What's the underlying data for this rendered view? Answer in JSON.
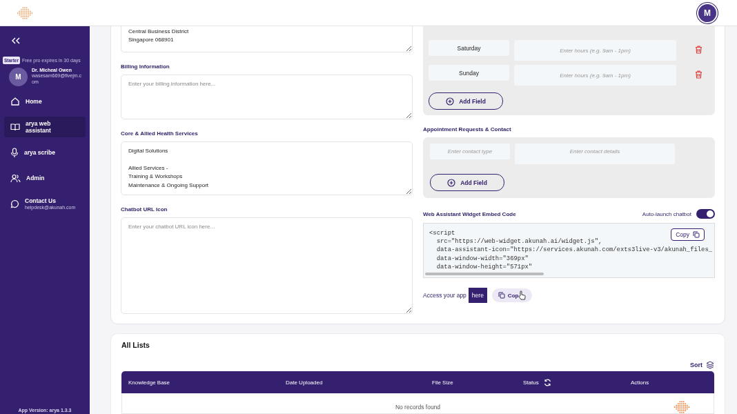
{
  "sidebar": {
    "plan_badge": "Starter",
    "plan_note": "Free pro expires in 30 days",
    "user": {
      "initial": "M",
      "name": "Dr. Micheal Owen",
      "email": "wasesam669@fivejm.com"
    },
    "items": [
      {
        "label": "Home",
        "selected": false
      },
      {
        "label": "arya web assistant",
        "selected": true
      },
      {
        "label": "arya scribe",
        "selected": false
      },
      {
        "label": "Admin",
        "selected": false
      },
      {
        "label": "Contact Us",
        "selected": false,
        "sub": "helpdesk@akunah.com"
      }
    ],
    "version": "App Version: arya 1.3.3"
  },
  "header": {
    "avatar": "M"
  },
  "form": {
    "address": {
      "value": "Central Business District\nSingapore 068901"
    },
    "billing": {
      "label": "Billing Information",
      "placeholder": "Enter your billing information here..."
    },
    "services": {
      "label": "Core & Allied Health Services",
      "value": "Digital Solutions\n\nAllied Services -\nTraining & Workshops\nMaintenance & Ongoing Support"
    },
    "chatbot_icon": {
      "label": "Chatbot URL Icon",
      "placeholder": "Enter your chatbot URL icon here..."
    },
    "hours": {
      "rows": [
        {
          "day": "Saturday",
          "placeholder": "Enter hours (e.g. 9am - 1pm)"
        },
        {
          "day": "Sunday",
          "placeholder": "Enter hours (e.g. 9am - 1pm)"
        }
      ],
      "add": "Add Field"
    },
    "contact": {
      "label": "Appointment Requests & Contact",
      "rows": [
        {
          "type_placeholder": "Enter contact type",
          "details_placeholder": "Enter contact details"
        }
      ],
      "add": "Add Field"
    },
    "embed": {
      "label": "Web Assistant Widget Embed Code",
      "toggle_label": "Auto-launch chatbot",
      "auto_launch": true,
      "code": [
        "<script",
        "  src=\"https://web-widget.akunah.ai/widget.js\",",
        "  data-assistant-icon=\"https://services.akunah.com/exts3live-v3/akunah_files_",
        "  data-window-width=\"369px\"",
        "  data-window-height=\"571px\""
      ],
      "copy": "Copy"
    },
    "access": {
      "text": "Access your app",
      "link": "here",
      "copy": "Cop"
    }
  },
  "lists": {
    "title": "All Lists",
    "sort": "Sort",
    "columns": [
      "Knowledge Base",
      "Date Uploaded",
      "File Size",
      "Status",
      "Actions"
    ],
    "empty": "No records found"
  }
}
